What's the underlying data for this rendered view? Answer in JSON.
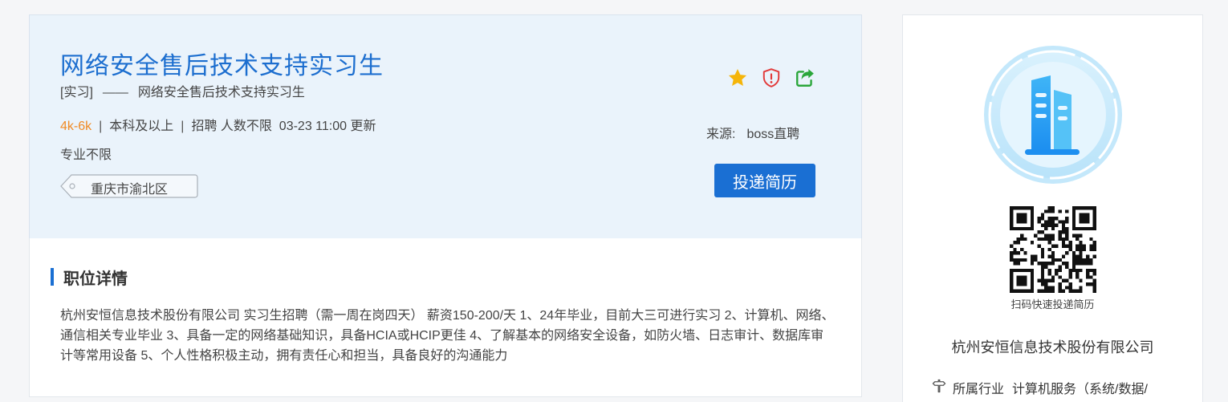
{
  "job": {
    "title": "网络安全售后技术支持实习生",
    "type_tag": "[实习]",
    "dash": "——",
    "subtitle": "网络安全售后技术支持实习生",
    "salary": "4k-6k",
    "separator": "|",
    "education": "本科及以上",
    "headcount": "招聘 人数不限",
    "updated": "03-23 11:00 更新",
    "major": "专业不限",
    "location": "重庆市渝北区",
    "source_label": "来源:",
    "source_value": "boss直聘",
    "apply_label": "投递简历"
  },
  "icons": {
    "favorite": "star-icon",
    "report": "shield-alert-icon",
    "share": "share-icon",
    "industry": "signpost-icon"
  },
  "details": {
    "heading": "职位详情",
    "body": "杭州安恒信息技术股份有限公司 实习生招聘（需一周在岗四天） 薪资150-200/天 1、24年毕业，目前大三可进行实习 2、计算机、网络、通信相关专业毕业 3、具备一定的网络基础知识，具备HCIA或HCIP更佳 4、了解基本的网络安全设备，如防火墙、日志审计、数据库审计等常用设备 5、个人性格积极主动，拥有责任心和担当，具备良好的沟通能力"
  },
  "company": {
    "qr_caption": "扫码快速投递简历",
    "name": "杭州安恒信息技术股份有限公司",
    "industry_label": "所属行业",
    "industry_value": "计算机服务（系统/数据/"
  },
  "colors": {
    "accent": "#1a6fd3",
    "title": "#1c6ecf",
    "salary": "#f08a24",
    "star": "#f5b50a",
    "report": "#e23a3a",
    "share": "#2aa63a"
  }
}
